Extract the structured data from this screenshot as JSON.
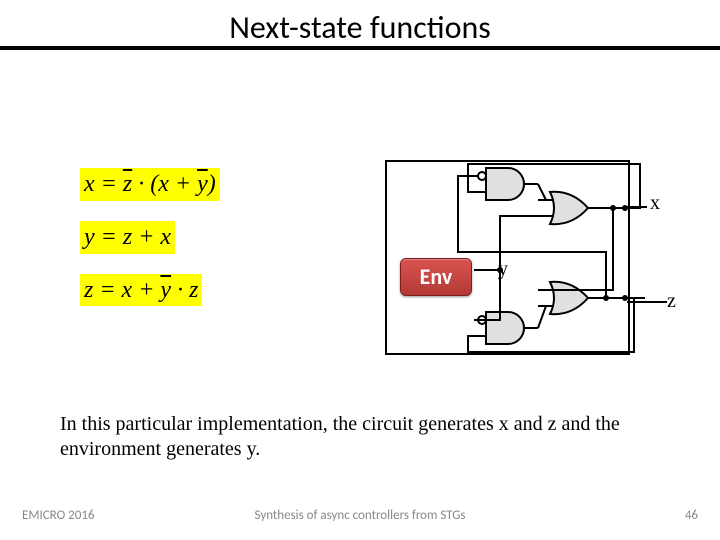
{
  "title": "Next-state functions",
  "equations": {
    "eq1": "x = z̄ · (x + ȳ)",
    "eq2": "y = z + x",
    "eq3": "z = x + ȳ · z"
  },
  "env_label": "Env",
  "signals": {
    "x": "x",
    "y": "y",
    "z": "z"
  },
  "caption": "In this particular implementation, the circuit generates x and z and the environment generates y.",
  "footer": {
    "left": "EMICRO 2016",
    "center": "Synthesis of async controllers from STGs",
    "page": "46"
  }
}
